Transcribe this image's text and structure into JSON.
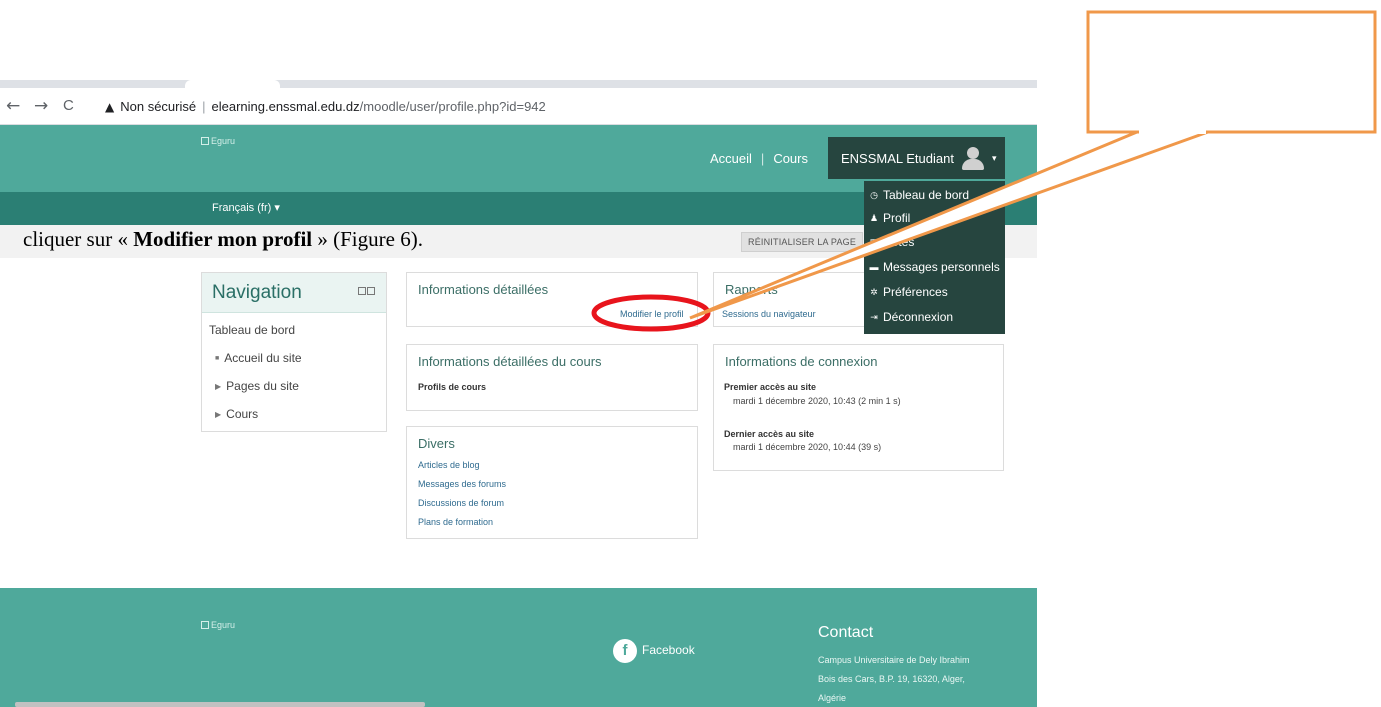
{
  "browser": {
    "back": "←",
    "forward": "→",
    "reload": "C",
    "security": "Non sécurisé",
    "url_host": "elearning.enssmal.edu.dz",
    "url_path": "/moodle/user/profile.php?id=942"
  },
  "header": {
    "logo_alt": "Eguru",
    "nav": [
      "Accueil",
      "Cours"
    ],
    "user_name": "ENSSMAL Etudiant",
    "language": "Français (fr) ▾"
  },
  "toolbar": {
    "reset_label": "RÉINITIALISER LA PAGE"
  },
  "overlay": {
    "prefix": "cliquer sur « ",
    "bold": "Modifier mon profil",
    "suffix": " » (Figure 6)."
  },
  "dropdown": {
    "items": [
      {
        "label": "Tableau de bord",
        "icon": "dashboard-icon",
        "glyph": "◷"
      },
      {
        "label": "Profil",
        "icon": "user-icon",
        "glyph": "♟"
      },
      {
        "label": "Notes",
        "icon": "grades-icon",
        "glyph": "▦"
      },
      {
        "label": "Messages personnels",
        "icon": "message-icon",
        "glyph": "▬"
      },
      {
        "label": "Préférences",
        "icon": "gear-icon",
        "glyph": "✲"
      },
      {
        "label": "Déconnexion",
        "icon": "logout-icon",
        "glyph": "⇥"
      }
    ]
  },
  "navigation": {
    "title": "Navigation",
    "items": [
      {
        "label": "Tableau de bord"
      },
      {
        "label": "Accueil du site"
      },
      {
        "label": "Pages du site"
      },
      {
        "label": "Cours"
      }
    ]
  },
  "details": {
    "title": "Informations détaillées",
    "edit_link": "Modifier le profil"
  },
  "reports": {
    "title": "Rapports",
    "link": "Sessions du navigateur"
  },
  "course_details": {
    "title": "Informations détaillées du cours",
    "label": "Profils de cours"
  },
  "login_info": {
    "title": "Informations de connexion",
    "first_label": "Premier accès au site",
    "first_value": "mardi 1 décembre 2020, 10:43  (2 min 1 s)",
    "last_label": "Dernier accès au site",
    "last_value": "mardi 1 décembre 2020, 10:44  (39 s)"
  },
  "misc": {
    "title": "Divers",
    "links": [
      "Articles de blog",
      "Messages des forums",
      "Discussions de forum",
      "Plans de formation"
    ]
  },
  "footer": {
    "logo_alt": "Eguru",
    "facebook_glyph": "f",
    "facebook": "Facebook",
    "contact_title": "Contact",
    "contact_lines": [
      "Campus Universitaire de Dely Ibrahim",
      "Bois des Cars, B.P. 19, 16320, Alger,",
      "Algérie"
    ]
  },
  "colors": {
    "header_teal": "#4fa99b",
    "lang_bar": "#2b7f74",
    "menu_dark": "#26453f",
    "annotation_orange": "#f0984a",
    "highlight_red": "#e8141c"
  }
}
